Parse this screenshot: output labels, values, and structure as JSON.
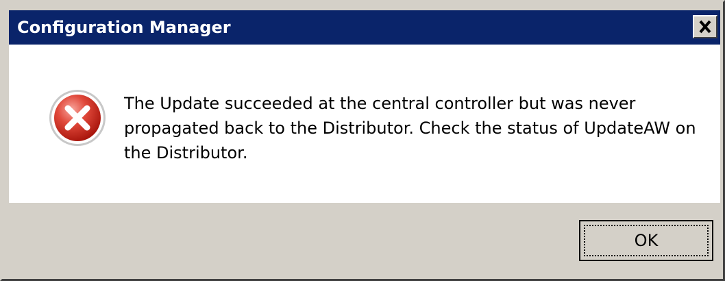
{
  "window": {
    "title": "Configuration Manager",
    "close_icon": "close-icon"
  },
  "message": {
    "icon": "error-icon",
    "text": "The Update succeeded at the central controller but was never propagated back to the Distributor. Check the status of UpdateAW on the Distributor."
  },
  "buttons": {
    "ok_label": "OK"
  },
  "colors": {
    "titlebar": "#0a246a",
    "dialog_face": "#d4d0c8",
    "error_red": "#d42a1e"
  }
}
